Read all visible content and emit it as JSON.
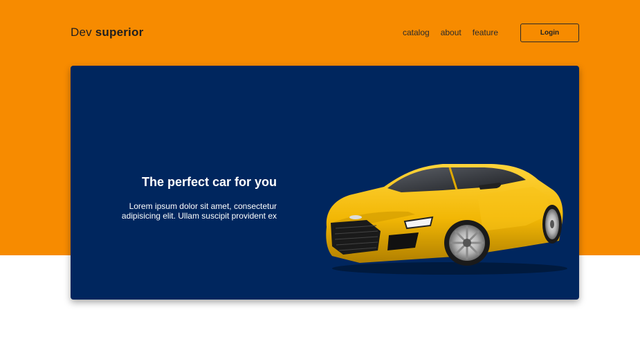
{
  "header": {
    "logo_regular": "Dev ",
    "logo_bold": "superior",
    "nav": [
      {
        "label": "catalog"
      },
      {
        "label": "about"
      },
      {
        "label": "feature"
      }
    ],
    "login_label": "Login"
  },
  "hero": {
    "title": "The perfect car for you",
    "description": "Lorem ipsum dolor sit amet, consectetur adipisicing elit. Ullam suscipit provident ex",
    "car_image": "yellow-sports-car"
  },
  "colors": {
    "accent": "#F78B00",
    "card_bg": "#00265E",
    "car_body": "#F2B705"
  }
}
